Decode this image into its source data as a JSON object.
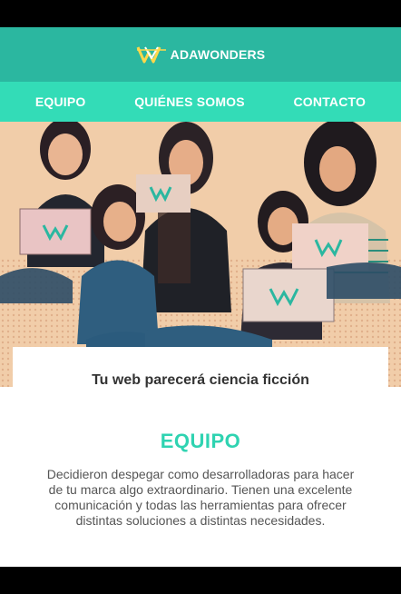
{
  "brand": {
    "name": "ADAWONDERS",
    "logo_icon": "adawonders-logo-icon"
  },
  "nav": {
    "items": [
      "EQUIPO",
      "QUIÉNES SOMOS",
      "CONTACTO"
    ]
  },
  "hero": {
    "tagline": "Tu web parecerá ciencia ficción"
  },
  "section": {
    "title": "EQUIPO",
    "text": "Decidieron despegar como desarrolladoras para hacer de tu marca algo extraordinario. Tienen una excelente comunicación y todas las herramientas para ofrecer distintas soluciones a distintas necesidades."
  },
  "colors": {
    "brand_bar": "#2bb7a0",
    "nav_bar": "#33dcb7",
    "accent": "#2fd3b1",
    "hero_bg": "#f1cda9"
  }
}
